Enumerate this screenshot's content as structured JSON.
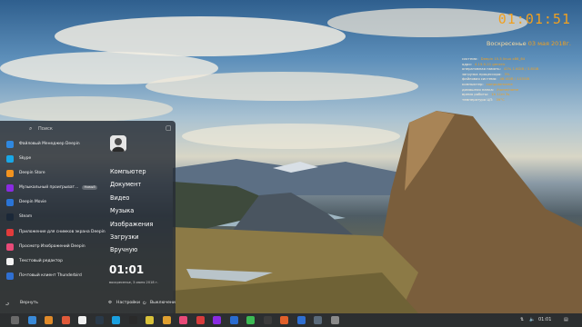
{
  "conky": {
    "clock": "01:01:51",
    "date_day": "Воскресенье",
    "date_rest": "03 мая 2018г.",
    "rows": [
      {
        "k": "система:",
        "v": "Deepin 15.5 linux x86_64"
      },
      {
        "k": "ядро:",
        "v": "4.15.0-21 generic"
      },
      {
        "k": "оперативная память:",
        "v": "42% 1.6GiB / 3.8GiB"
      },
      {
        "k": "загрузка процессора:",
        "v": "3%"
      },
      {
        "k": "файловая система:",
        "v": "46.4GiB / 143GiB"
      },
      {
        "k": "компьютер:",
        "v": "computername"
      },
      {
        "k": "домашняя папка:",
        "v": "/home/name"
      },
      {
        "k": "время работы:",
        "v": "1h 11m 3s"
      },
      {
        "k": "температура ЦП:",
        "v": "39°C"
      }
    ]
  },
  "launcher": {
    "search_placeholder": "Поиск",
    "apps": [
      {
        "label": "Файловый Менеджер Deepin",
        "color": "#2f88e0",
        "badge": ""
      },
      {
        "label": "Skype",
        "color": "#19a7e6",
        "badge": ""
      },
      {
        "label": "Deepin Store",
        "color": "#f2931f",
        "badge": ""
      },
      {
        "label": "Музыкальный проигрыват...",
        "color": "#8a2be2",
        "badge": "Новый"
      },
      {
        "label": "Deepin Movie",
        "color": "#2a74d6",
        "badge": ""
      },
      {
        "label": "Steam",
        "color": "#1b2838",
        "badge": ""
      },
      {
        "label": "Приложение для снимков экрана Deepin",
        "color": "#e23b3b",
        "badge": ""
      },
      {
        "label": "Просмотр Изображений Deepin",
        "color": "#e84a78",
        "badge": ""
      },
      {
        "label": "Текстовый редактор",
        "color": "#f3f3f3",
        "badge": ""
      },
      {
        "label": "Почтовый клиент Thunderbird",
        "color": "#2f6fd1",
        "badge": ""
      }
    ],
    "folders": [
      "Компьютер",
      "Документ",
      "Видео",
      "Музыка",
      "Изображения",
      "Загрузки",
      "Вручную"
    ],
    "clock": "01:01",
    "date": "воскресенье, 3 июня 2018 г.",
    "back_label": "Вернуть",
    "settings_label": "Настройки",
    "power_label": "Выключени"
  },
  "dock": {
    "icons": [
      {
        "name": "launcher-icon",
        "color": "#6a6a6a"
      },
      {
        "name": "deepin-file-manager-icon",
        "color": "#3a8ad8"
      },
      {
        "name": "deepin-store-icon",
        "color": "#e08a2a"
      },
      {
        "name": "calendar-icon",
        "color": "#e05a3a"
      },
      {
        "name": "text-editor-icon",
        "color": "#f0f0f0"
      },
      {
        "name": "steam-icon",
        "color": "#2a3a4a"
      },
      {
        "name": "skype-icon",
        "color": "#1aa0e0"
      },
      {
        "name": "terminal-icon",
        "color": "#2a2a2a"
      },
      {
        "name": "paint-icon",
        "color": "#d9c23a"
      },
      {
        "name": "cleaner-icon",
        "color": "#e0a030"
      },
      {
        "name": "image-viewer-icon",
        "color": "#e84a78"
      },
      {
        "name": "screenshot-icon",
        "color": "#d83c3c"
      },
      {
        "name": "music-icon",
        "color": "#8a2be2"
      },
      {
        "name": "video-icon",
        "color": "#2a6cd0"
      },
      {
        "name": "chrome-icon",
        "color": "#3cba54"
      },
      {
        "name": "monitor-icon",
        "color": "#3c3c3c"
      },
      {
        "name": "downloader-icon",
        "color": "#e0602a"
      },
      {
        "name": "mail-icon",
        "color": "#2f6fd1"
      },
      {
        "name": "settings-icon",
        "color": "#5a6a7a"
      },
      {
        "name": "trash-icon",
        "color": "#8a8a8a"
      }
    ],
    "time": "01:01"
  }
}
